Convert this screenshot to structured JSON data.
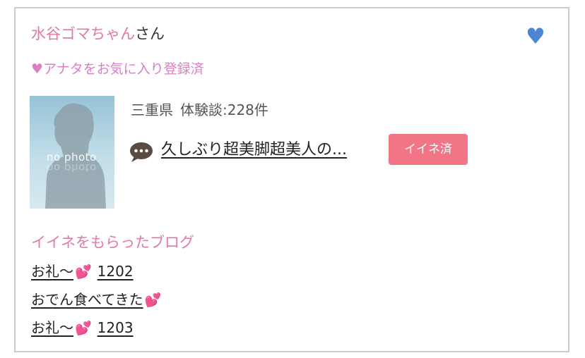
{
  "user": {
    "name": "水谷ゴマちゃん",
    "suffix": "さん",
    "favorite_status": "♥アナタをお気に入り登録済"
  },
  "icons": {
    "favorite": "heart-icon",
    "review": "speech-bubble-icon",
    "blog_emoji": "two-hearts-icon"
  },
  "colors": {
    "user_name": "#e07a9a",
    "favorite_status": "#d97fc6",
    "heart": "#4d84d6",
    "like_badge": "#f27586",
    "blog_heading": "#e07aa8",
    "emoji": "#e0447f"
  },
  "profile": {
    "photo_text": "no photo",
    "prefecture": "三重県",
    "review_count": "体験談:228件"
  },
  "review": {
    "title": "久しぶり超美脚超美人の...",
    "like_label": "イイネ済"
  },
  "blogs": {
    "heading": "イイネをもらったブログ",
    "items": [
      {
        "title": "お礼～",
        "emoji": "💕",
        "suffix": "1202"
      },
      {
        "title": "おでん食べてきた",
        "emoji": "💕",
        "suffix": ""
      },
      {
        "title": "お礼～",
        "emoji": "💕",
        "suffix": "1203"
      }
    ]
  }
}
